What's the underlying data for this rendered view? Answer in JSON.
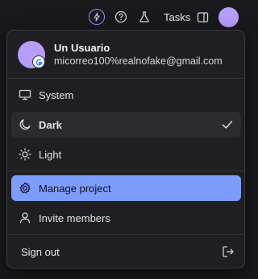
{
  "topbar": {
    "tasks_label": "Tasks",
    "icons": [
      "bolt-icon",
      "help-icon",
      "flask-icon",
      "panel-icon"
    ]
  },
  "user": {
    "name": "Un Usuario",
    "email": "micorreo100%realnofake@gmail.com",
    "provider_badge": "G"
  },
  "theme_items": [
    {
      "label": "System",
      "icon": "monitor-icon"
    },
    {
      "label": "Dark",
      "icon": "moon-icon",
      "selected": true
    },
    {
      "label": "Light",
      "icon": "sun-icon"
    }
  ],
  "actions": [
    {
      "label": "Manage project",
      "icon": "gear-icon",
      "active": true
    },
    {
      "label": "Invite members",
      "icon": "user-icon"
    }
  ],
  "sign_out": {
    "label": "Sign out",
    "icon": "sign-out-icon"
  },
  "colors": {
    "background": "#19191b",
    "menu": "#1f1f22",
    "accent": "#7c9dfb",
    "avatar": "#b69cfb",
    "bolt_ring": "#8a93ff"
  }
}
